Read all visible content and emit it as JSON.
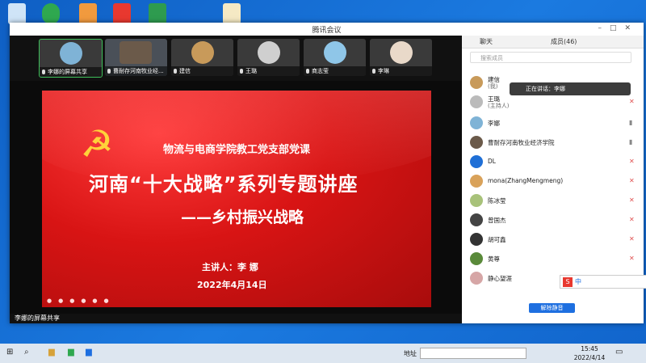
{
  "window": {
    "title": "腾讯会议"
  },
  "strip": {
    "tiles": [
      {
        "name": "李娜的屏幕共享"
      },
      {
        "name": "曹耐存河南牧业经..."
      },
      {
        "name": "建信"
      },
      {
        "name": "王璐"
      },
      {
        "name": "商志莹"
      },
      {
        "name": "李琳"
      }
    ]
  },
  "slide": {
    "subtitle": "物流与电商学院教工党支部党课",
    "title": "河南“十大战略”系列专题讲座",
    "subtitle2": "——乡村振兴战略",
    "speaker": "主讲人：李 娜",
    "date": "2022年4月14日"
  },
  "share_bar": {
    "label": "李娜的屏幕共享"
  },
  "panel": {
    "tab_chat": "聊天",
    "tab_members": "成员(46)",
    "search_placeholder": "搜索成员",
    "speaking": "正在讲话：李娜",
    "members": [
      {
        "name": "建信",
        "note": "(我)"
      },
      {
        "name": "王璐",
        "note": "(主持人)"
      },
      {
        "name": "李娜",
        "note": ""
      },
      {
        "name": "曹耐存河南牧业经济学院",
        "note": ""
      },
      {
        "name": "DL",
        "note": ""
      },
      {
        "name": "mona(ZhangMengmeng)",
        "note": ""
      },
      {
        "name": "陈冰莹",
        "note": ""
      },
      {
        "name": "曾国杰",
        "note": ""
      },
      {
        "name": "胡可鑫",
        "note": ""
      },
      {
        "name": "黄尊",
        "note": ""
      },
      {
        "name": "静心望涯",
        "note": ""
      }
    ],
    "unmute_all": "解除静音"
  },
  "ime": {
    "label": "中"
  },
  "taskbar": {
    "address_label": "地址",
    "time": "15:45",
    "date": "2022/4/14"
  },
  "colors": {
    "accent": "#1e6fe0",
    "slide_red": "#d81414",
    "active_border": "#3ebf5a"
  }
}
